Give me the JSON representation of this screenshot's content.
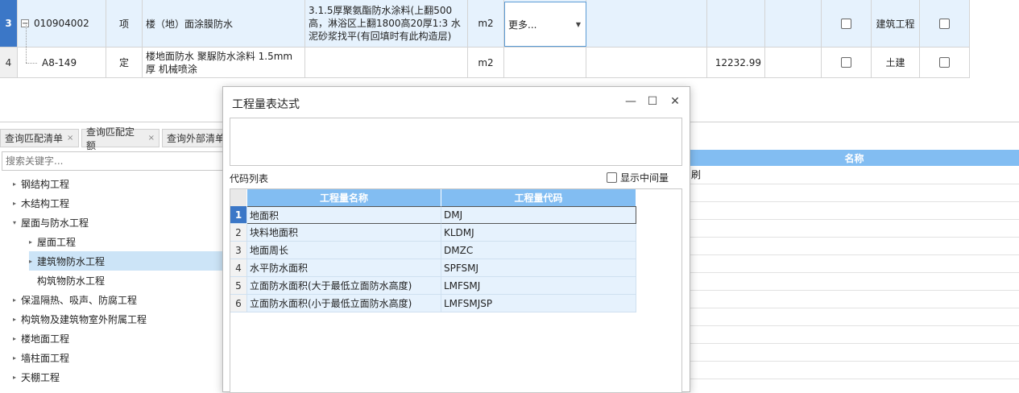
{
  "grid": {
    "rows": [
      {
        "num": "3",
        "expand": "−",
        "code": "010904002",
        "type": "项",
        "name": "楼（地）面涂膜防水",
        "feature": "3.1.5厚聚氨酯防水涂料(上翻500高，淋浴区上翻1800高20厚1:3 水泥砂浆找平(有回填时有此构造层)",
        "unit": "m2",
        "expr": "更多...",
        "qty": "",
        "major": "建筑工程"
      },
      {
        "num": "4",
        "code": "A8-149",
        "type": "定",
        "name": "楼地面防水 聚脲防水涂料 1.5mm厚 机械喷涂",
        "feature": "",
        "unit": "m2",
        "expr": "",
        "qty": "12232.99",
        "major": "土建"
      }
    ]
  },
  "tabs": [
    {
      "label": "查询匹配清单",
      "close": "×"
    },
    {
      "label": "查询匹配定额",
      "close": "×"
    },
    {
      "label": "查询外部清单",
      "close": ""
    }
  ],
  "search": {
    "placeholder": "搜索关键字..."
  },
  "tree": [
    {
      "label": "钢结构工程",
      "arrow": "▸"
    },
    {
      "label": "木结构工程",
      "arrow": "▸"
    },
    {
      "label": "屋面与防水工程",
      "arrow": "▾"
    },
    {
      "label": "屋面工程",
      "arrow": "▸"
    },
    {
      "label": "建筑物防水工程",
      "arrow": "▸"
    },
    {
      "label": "构筑物防水工程",
      "arrow": ""
    },
    {
      "label": "保温隔热、吸声、防腐工程",
      "arrow": "▸"
    },
    {
      "label": "构筑物及建筑物室外附属工程",
      "arrow": "▸"
    },
    {
      "label": "楼地面工程",
      "arrow": "▸"
    },
    {
      "label": "墙柱面工程",
      "arrow": "▸"
    },
    {
      "label": "天棚工程",
      "arrow": "▸"
    }
  ],
  "right_panel": {
    "header": "名称",
    "partial_text": "刷"
  },
  "dialog": {
    "title": "工程量表达式",
    "minimize": "—",
    "maximize": "☐",
    "close": "✕",
    "code_list_label": "代码列表",
    "show_mid_label": "显示中间量",
    "columns": [
      "工程量名称",
      "工程量代码"
    ],
    "rows": [
      {
        "num": "1",
        "name": "地面积",
        "code": "DMJ"
      },
      {
        "num": "2",
        "name": "块料地面积",
        "code": "KLDMJ"
      },
      {
        "num": "3",
        "name": "地面周长",
        "code": "DMZC"
      },
      {
        "num": "4",
        "name": "水平防水面积",
        "code": "SPFSMJ"
      },
      {
        "num": "5",
        "name": "立面防水面积(大于最低立面防水高度)",
        "code": "LMFSMJ"
      },
      {
        "num": "6",
        "name": "立面防水面积(小于最低立面防水高度)",
        "code": "LMFSMJSP"
      }
    ]
  },
  "colors": {
    "header_blue": "#82bdf2",
    "selected_blue": "#3b77c7",
    "row_tint": "#e6f2fd"
  }
}
